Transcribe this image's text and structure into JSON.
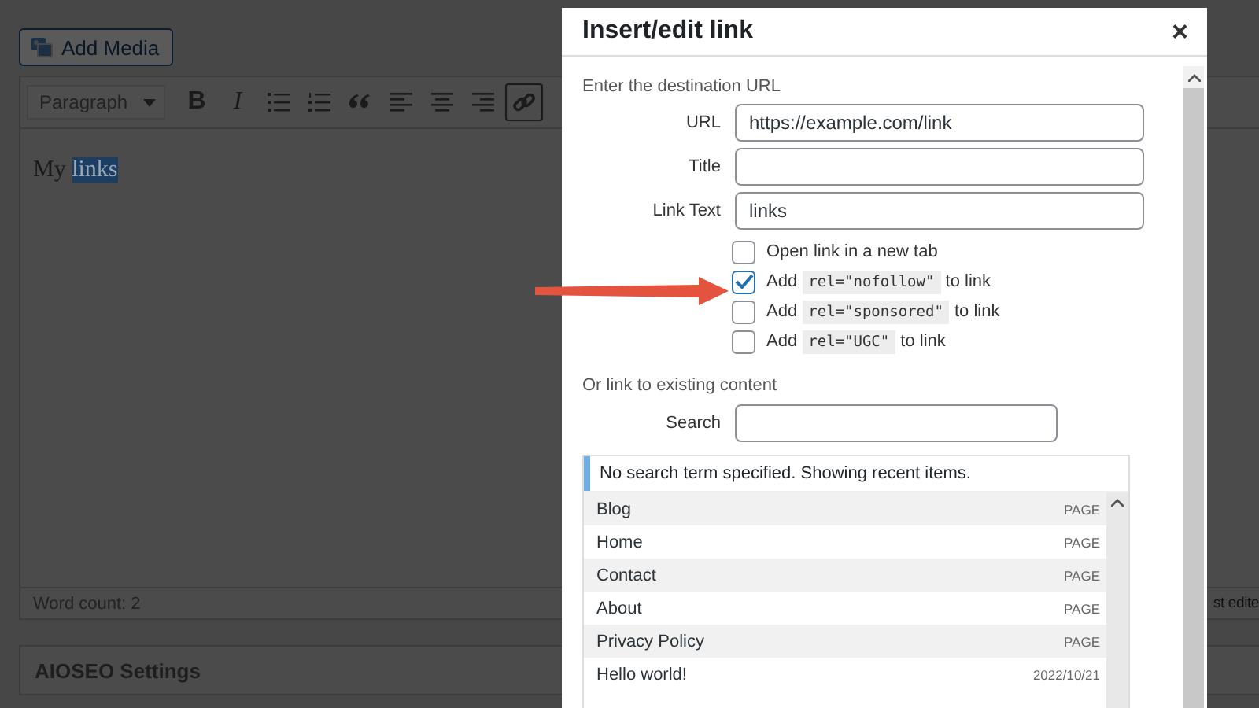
{
  "editor": {
    "add_media": "Add Media",
    "format_select": "Paragraph",
    "toolbar": [
      {
        "kind": "bold",
        "label": "B",
        "selected": false
      },
      {
        "kind": "italic",
        "label": "I",
        "selected": false
      },
      {
        "kind": "bullets",
        "selected": false
      },
      {
        "kind": "numbers",
        "selected": false
      },
      {
        "kind": "quote",
        "selected": false
      },
      {
        "kind": "align-left",
        "selected": false
      },
      {
        "kind": "align-center",
        "selected": false
      },
      {
        "kind": "align-right",
        "selected": false
      },
      {
        "kind": "link",
        "selected": true
      }
    ],
    "content_plain": "My",
    "content_selected": "links",
    "word_count": "Word count: 2",
    "last_edited": "st edite"
  },
  "settings_panel": {
    "title": "AIOSEO Settings"
  },
  "dialog": {
    "title": "Insert/edit link",
    "close": "×",
    "url_heading": "Enter the destination URL",
    "fields": [
      {
        "label": "URL",
        "value": "https://example.com/link"
      },
      {
        "label": "Title"
      },
      {
        "label": "Link Text",
        "value": "links"
      }
    ],
    "options": [
      {
        "kind": "plain",
        "label": "Open link in a new tab",
        "checked": false
      },
      {
        "kind": "rel",
        "before": "Add",
        "code": "rel=\"nofollow\"",
        "after": "to link",
        "checked": true
      },
      {
        "kind": "rel",
        "before": "Add",
        "code": "rel=\"sponsored\"",
        "after": "to link",
        "checked": false
      },
      {
        "kind": "rel",
        "before": "Add",
        "code": "rel=\"UGC\"",
        "after": "to link",
        "checked": false
      }
    ],
    "existing_heading": "Or link to existing content",
    "search": {
      "label": "Search"
    },
    "notice": "No search term specified. Showing recent items.",
    "results": [
      {
        "title": "Blog",
        "info": "PAGE"
      },
      {
        "title": "Home",
        "info": "PAGE"
      },
      {
        "title": "Contact",
        "info": "PAGE"
      },
      {
        "title": "About",
        "info": "PAGE"
      },
      {
        "title": "Privacy Policy",
        "info": "PAGE"
      },
      {
        "title": "Hello world!",
        "info": "2022/10/21"
      }
    ]
  }
}
